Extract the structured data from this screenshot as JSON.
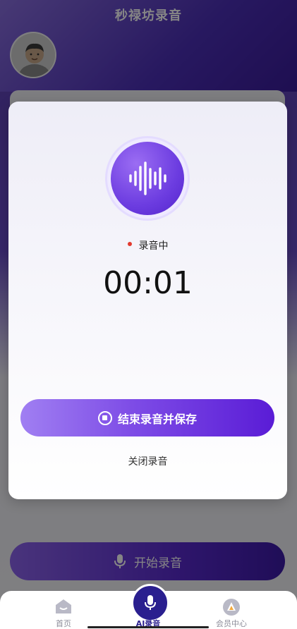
{
  "app": {
    "title": "秒禄坊录音"
  },
  "main": {
    "start_button_label": "开始录音"
  },
  "modal": {
    "status_text": "录音中",
    "timer": "00:01",
    "stop_button_label": "结束录音并保存",
    "close_link_label": "关闭录音"
  },
  "nav": {
    "items": [
      {
        "label": "首页",
        "icon": "home-icon"
      },
      {
        "label": "AI录音",
        "icon": "mic-icon",
        "active": true
      },
      {
        "label": "会员中心",
        "icon": "vip-icon"
      }
    ]
  },
  "colors": {
    "accent": "#6c3ce0",
    "nav_active": "#2a1f8f",
    "recording_dot": "#e23a2e"
  }
}
